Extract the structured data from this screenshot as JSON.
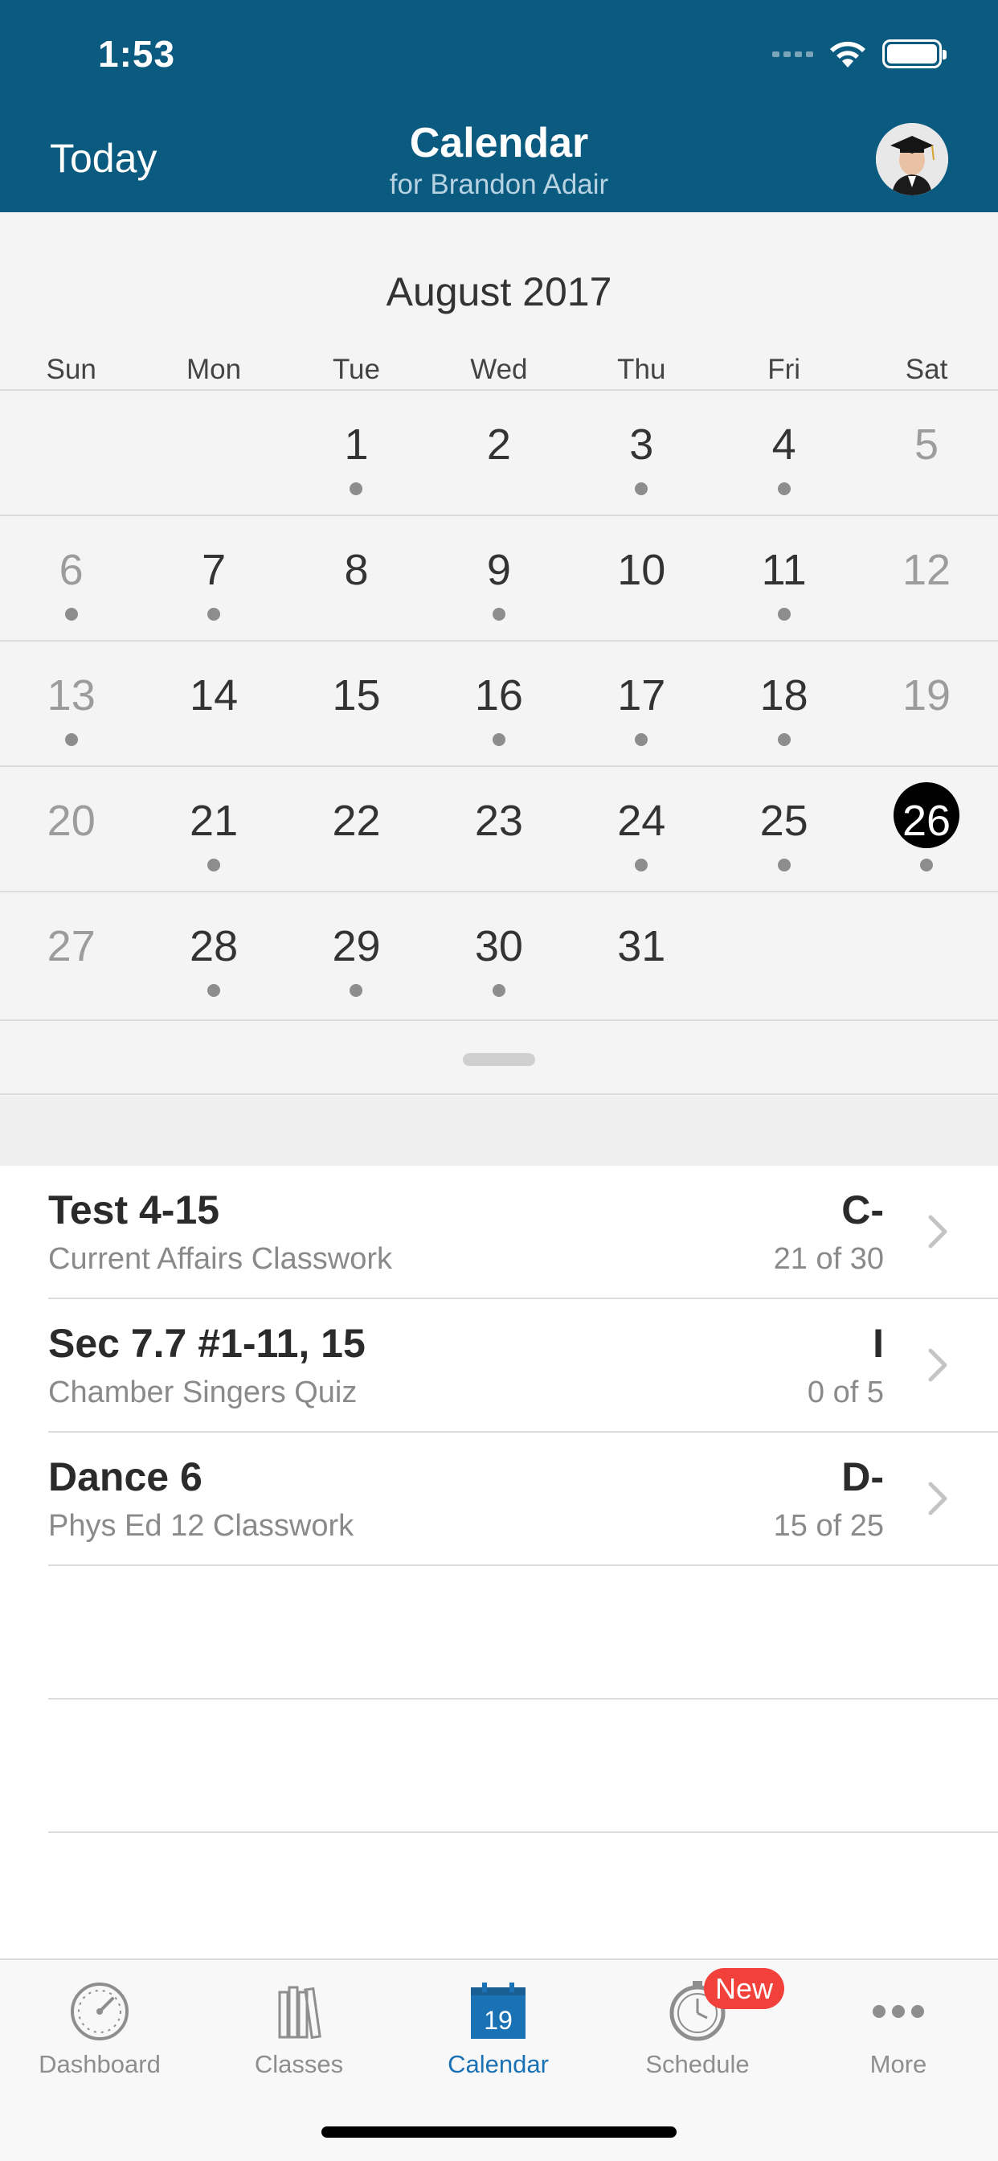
{
  "status_bar": {
    "time": "1:53"
  },
  "header": {
    "today_label": "Today",
    "title": "Calendar",
    "subtitle": "for Brandon Adair"
  },
  "calendar": {
    "month_label": "August 2017",
    "days_of_week": [
      "Sun",
      "Mon",
      "Tue",
      "Wed",
      "Thu",
      "Fri",
      "Sat"
    ],
    "weeks": [
      [
        null,
        null,
        {
          "d": "1",
          "dot": true
        },
        {
          "d": "2",
          "dot": false
        },
        {
          "d": "3",
          "dot": true
        },
        {
          "d": "4",
          "dot": true
        },
        {
          "d": "5",
          "dot": false
        }
      ],
      [
        {
          "d": "6",
          "dot": true
        },
        {
          "d": "7",
          "dot": true
        },
        {
          "d": "8",
          "dot": false
        },
        {
          "d": "9",
          "dot": true
        },
        {
          "d": "10",
          "dot": false
        },
        {
          "d": "11",
          "dot": true
        },
        {
          "d": "12",
          "dot": false
        }
      ],
      [
        {
          "d": "13",
          "dot": true
        },
        {
          "d": "14",
          "dot": false
        },
        {
          "d": "15",
          "dot": false
        },
        {
          "d": "16",
          "dot": true
        },
        {
          "d": "17",
          "dot": true
        },
        {
          "d": "18",
          "dot": true
        },
        {
          "d": "19",
          "dot": false
        }
      ],
      [
        {
          "d": "20",
          "dot": false
        },
        {
          "d": "21",
          "dot": true
        },
        {
          "d": "22",
          "dot": false
        },
        {
          "d": "23",
          "dot": false
        },
        {
          "d": "24",
          "dot": true
        },
        {
          "d": "25",
          "dot": true
        },
        {
          "d": "26",
          "dot": true,
          "selected": true
        }
      ],
      [
        {
          "d": "27",
          "dot": false
        },
        {
          "d": "28",
          "dot": true
        },
        {
          "d": "29",
          "dot": true
        },
        {
          "d": "30",
          "dot": true
        },
        {
          "d": "31",
          "dot": false
        },
        null,
        null
      ]
    ]
  },
  "assignments": [
    {
      "title": "Test 4-15",
      "subtitle": "Current Affairs Classwork",
      "grade": "C-",
      "score": "21 of 30"
    },
    {
      "title": "Sec 7.7 #1-11, 15",
      "subtitle": "Chamber Singers Quiz",
      "grade": "I",
      "score": "0 of 5"
    },
    {
      "title": "Dance 6",
      "subtitle": "Phys Ed 12 Classwork",
      "grade": "D-",
      "score": "15 of 25"
    }
  ],
  "tabbar": {
    "tabs": [
      {
        "label": "Dashboard",
        "icon": "dashboard-gauge-icon",
        "active": false
      },
      {
        "label": "Classes",
        "icon": "books-icon",
        "active": false
      },
      {
        "label": "Calendar",
        "icon": "calendar-icon",
        "calendar_day": "19",
        "active": true
      },
      {
        "label": "Schedule",
        "icon": "stopwatch-icon",
        "active": false,
        "badge": "New"
      },
      {
        "label": "More",
        "icon": "more-dots-icon",
        "active": false
      }
    ]
  },
  "colors": {
    "header_bg": "#0b5a80",
    "active_tab": "#1a72b4",
    "badge": "#f2403b",
    "calendar_bg": "#f4f4f4"
  }
}
